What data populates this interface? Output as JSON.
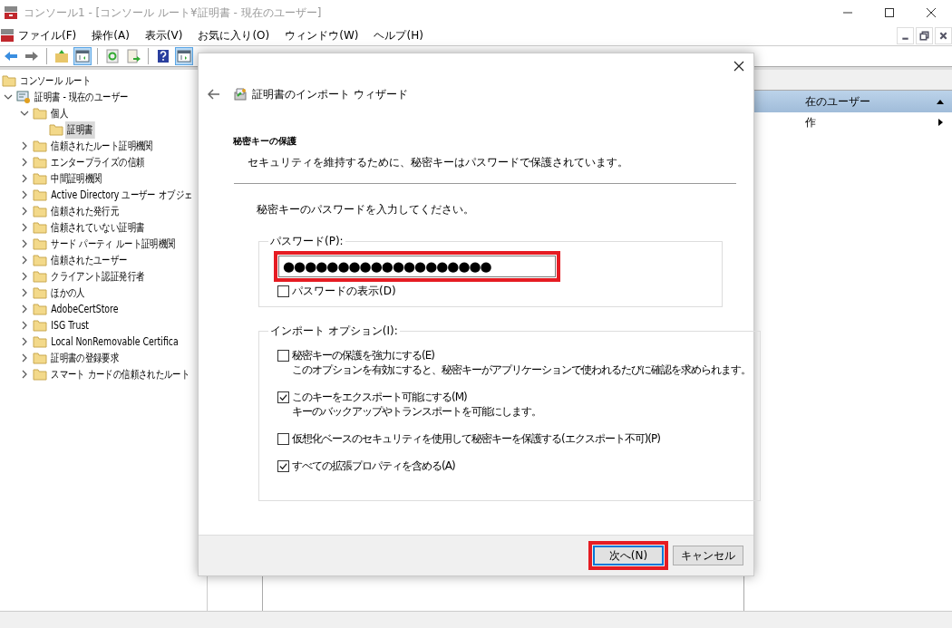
{
  "window": {
    "title": "コンソール1 - [コンソール ルート¥証明書 - 現在のユーザー]"
  },
  "menu": [
    "ファイル(F)",
    "操作(A)",
    "表示(V)",
    "お気に入り(O)",
    "ウィンドウ(W)",
    "ヘルプ(H)"
  ],
  "toolbar": [
    {
      "kind": "back",
      "pressed": false
    },
    {
      "kind": "forward",
      "pressed": false
    },
    {
      "kind": "sep"
    },
    {
      "kind": "up",
      "pressed": false
    },
    {
      "kind": "tree",
      "pressed": true
    },
    {
      "kind": "sep"
    },
    {
      "kind": "refresh",
      "pressed": false
    },
    {
      "kind": "export",
      "pressed": false
    },
    {
      "kind": "sep"
    },
    {
      "kind": "help",
      "pressed": false
    },
    {
      "kind": "pane",
      "pressed": true
    }
  ],
  "tree": [
    {
      "label": "コンソール ルート",
      "kind": "folder",
      "selected": false,
      "children": [
        {
          "label": "証明書 - 現在のユーザー",
          "kind": "store",
          "expanded": true,
          "selected": false,
          "children": [
            {
              "label": "個人",
              "kind": "folder",
              "expanded": true,
              "selected": false,
              "children": [
                {
                  "label": "証明書",
                  "kind": "folder",
                  "selected": true
                }
              ]
            },
            {
              "label": "信頼されたルート証明機関",
              "kind": "folder",
              "expanded": false,
              "selected": false
            },
            {
              "label": "エンタープライズの信頼",
              "kind": "folder",
              "expanded": false,
              "selected": false
            },
            {
              "label": "中間証明機関",
              "kind": "folder",
              "expanded": false,
              "selected": false
            },
            {
              "label": "Active Directory ユーザー オブジェ",
              "kind": "folder",
              "expanded": false,
              "selected": false
            },
            {
              "label": "信頼された発行元",
              "kind": "folder",
              "expanded": false,
              "selected": false
            },
            {
              "label": "信頼されていない証明書",
              "kind": "folder",
              "expanded": false,
              "selected": false
            },
            {
              "label": "サード パーティ ルート証明機関",
              "kind": "folder",
              "expanded": false,
              "selected": false
            },
            {
              "label": "信頼されたユーザー",
              "kind": "folder",
              "expanded": false,
              "selected": false
            },
            {
              "label": "クライアント認証発行者",
              "kind": "folder",
              "expanded": false,
              "selected": false
            },
            {
              "label": "ほかの人",
              "kind": "folder",
              "expanded": false,
              "selected": false
            },
            {
              "label": "AdobeCertStore",
              "kind": "folder",
              "expanded": false,
              "selected": false
            },
            {
              "label": "ISG Trust",
              "kind": "folder",
              "expanded": false,
              "selected": false
            },
            {
              "label": "Local NonRemovable Certifica",
              "kind": "folder",
              "expanded": false,
              "selected": false
            },
            {
              "label": "証明書の登録要求",
              "kind": "folder",
              "expanded": false,
              "selected": false
            },
            {
              "label": "スマート カードの信頼されたルート",
              "kind": "folder",
              "expanded": false,
              "selected": false
            }
          ]
        }
      ]
    }
  ],
  "actions": {
    "header": "在のユーザー",
    "items": [
      "作"
    ]
  },
  "dialog": {
    "title": "証明書のインポート ウィザード",
    "heading": "秘密キーの保護",
    "subheading": "セキュリティを維持するために、秘密キーはパスワードで保護されています。",
    "prompt": "秘密キーのパスワードを入力してください。",
    "password": {
      "legend": "パスワード(P):",
      "value": "●●●●●●●●●●●●●●●●●●●",
      "highlighted": true,
      "show_label": "パスワードの表示(D)",
      "show_checked": false
    },
    "options": {
      "legend": "インポート オプション(I):",
      "items": [
        {
          "label": "秘密キーの保護を強力にする(E)",
          "description": "このオプションを有効にすると、秘密キーがアプリケーションで使われるたびに確認を求められます。",
          "checked": false
        },
        {
          "label": "このキーをエクスポート可能にする(M)",
          "description": "キーのバックアップやトランスポートを可能にします。",
          "checked": true
        },
        {
          "label": "仮想化ベースのセキュリティを使用して秘密キーを保護する(エクスポート不可)(P)",
          "checked": false
        },
        {
          "label": "すべての拡張プロパティを含める(A)",
          "checked": true
        }
      ]
    },
    "buttons": [
      {
        "label": "次へ(N)",
        "default": true,
        "highlighted": true
      },
      {
        "label": "キャンセル",
        "default": false,
        "highlighted": false
      }
    ]
  }
}
